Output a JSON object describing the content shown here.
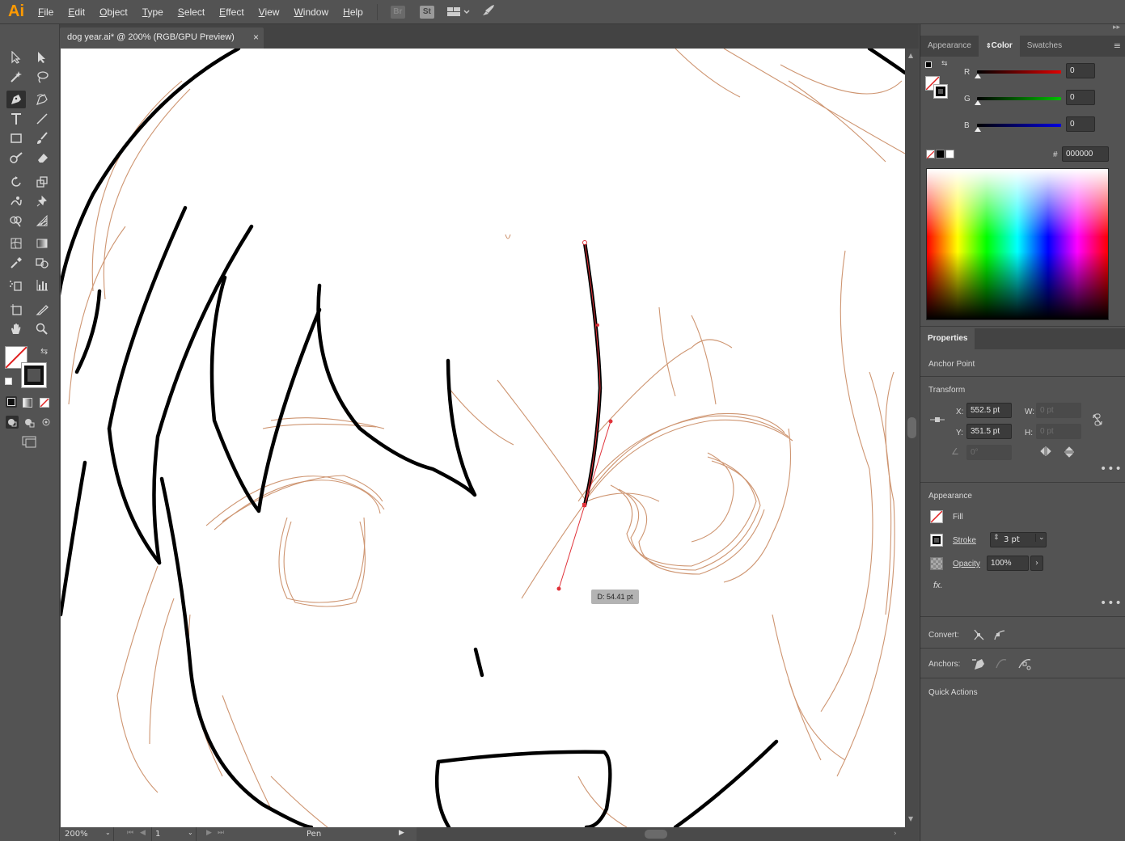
{
  "app": {
    "logo": "Ai",
    "accent": "#ff9a00"
  },
  "menu": {
    "items": [
      "File",
      "Edit",
      "Object",
      "Type",
      "Select",
      "Effect",
      "View",
      "Window",
      "Help"
    ],
    "bridge_label": "Br",
    "stock_label": "St"
  },
  "document": {
    "tab_title": "dog year.ai* @ 200% (RGB/GPU Preview)",
    "close_glyph": "×"
  },
  "canvas": {
    "measure_tooltip": "D: 54.41 pt"
  },
  "status": {
    "zoom": "200%",
    "artboard": "1",
    "tool_name": "Pen"
  },
  "color_panel": {
    "tabs": [
      "Appearance",
      "Color",
      "Swatches"
    ],
    "active_tab": "Color",
    "channels": [
      {
        "label": "R",
        "value": "0",
        "color": "#e00000"
      },
      {
        "label": "G",
        "value": "0",
        "color": "#00c000"
      },
      {
        "label": "B",
        "value": "0",
        "color": "#0000e0"
      }
    ],
    "hex_label": "#",
    "hex_value": "000000"
  },
  "properties": {
    "tab": "Properties",
    "selection_type": "Anchor Point",
    "transform": {
      "heading": "Transform",
      "x_label": "X:",
      "x_value": "552.5 pt",
      "y_label": "Y:",
      "y_value": "351.5 pt",
      "w_label": "W:",
      "w_value": "0 pt",
      "h_label": "H:",
      "h_value": "0 pt",
      "angle_value": "0°"
    },
    "appearance": {
      "heading": "Appearance",
      "fill_label": "Fill",
      "stroke_label": "Stroke",
      "stroke_value": "3 pt",
      "opacity_label": "Opacity",
      "opacity_value": "100%",
      "fx_label": "fx."
    },
    "convert_label": "Convert:",
    "anchors_label": "Anchors:",
    "quick_actions": "Quick Actions"
  }
}
